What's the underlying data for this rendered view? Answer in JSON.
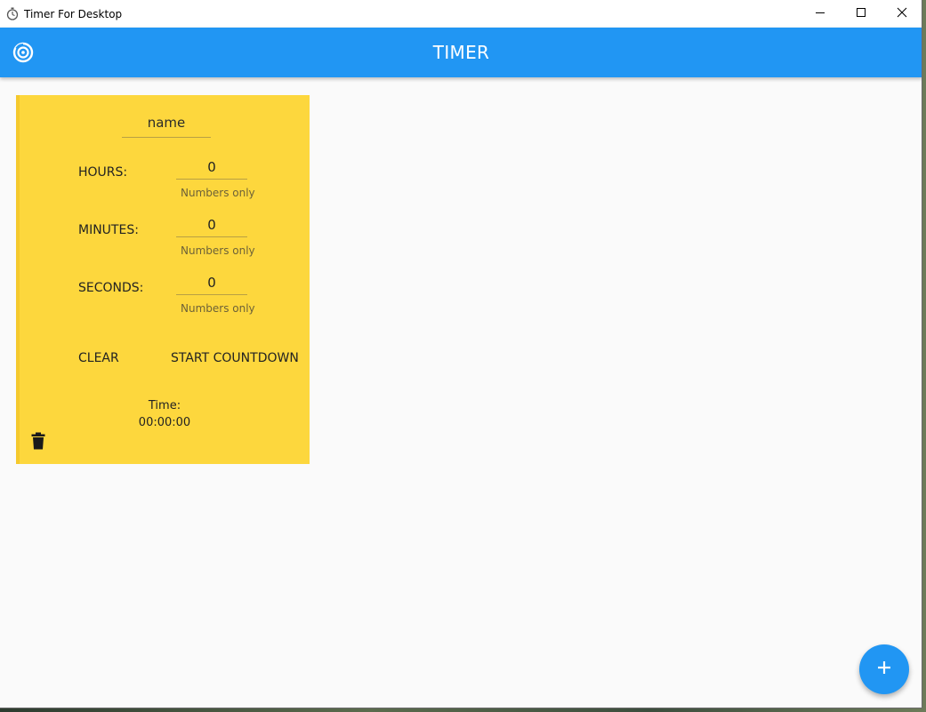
{
  "window": {
    "title": "Timer For Desktop",
    "controls": [
      "minimize-icon",
      "maximize-icon",
      "close-icon"
    ]
  },
  "appbar": {
    "title": "TIMER",
    "logo_icon": "timer-logo-icon",
    "color": "#2196f3"
  },
  "timer_card": {
    "color": "#fdd73d",
    "name_value": "name",
    "fields": [
      {
        "label": "HOURS:",
        "value": "0",
        "helper": "Numbers only"
      },
      {
        "label": "MINUTES:",
        "value": "0",
        "helper": "Numbers only"
      },
      {
        "label": "SECONDS:",
        "value": "0",
        "helper": "Numbers only"
      }
    ],
    "clear_label": "CLEAR",
    "start_label": "START COUNTDOWN",
    "time_label": "Time:",
    "time_value": "00:00:00",
    "delete_icon": "trash-icon"
  },
  "fab": {
    "icon": "plus-icon",
    "color": "#2196f3"
  }
}
